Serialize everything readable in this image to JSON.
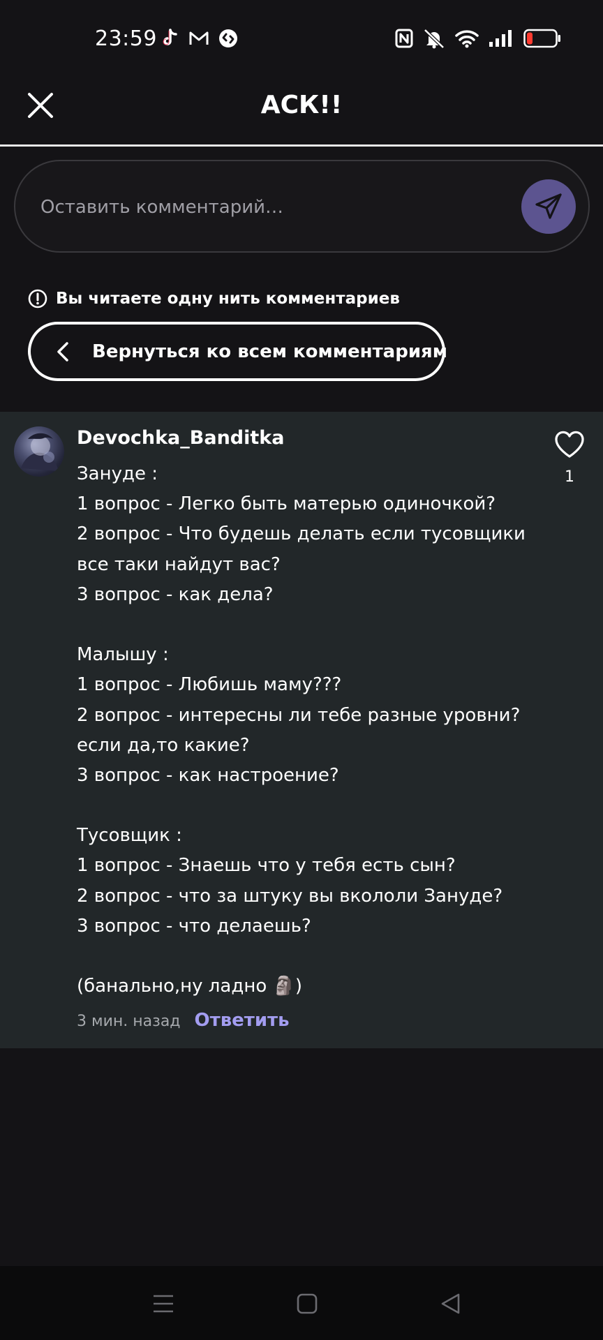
{
  "status_bar": {
    "time": "23:59",
    "left_icons": [
      "tiktok-icon",
      "gmail-icon",
      "shazam-icon"
    ],
    "right_icons": [
      "nfc-icon",
      "mute-icon",
      "wifi-icon",
      "signal-icon",
      "battery-low-icon"
    ]
  },
  "header": {
    "title": "АСК!!",
    "close_icon": "close-icon"
  },
  "comment_input": {
    "placeholder": "Оставить комментарий…",
    "value": "",
    "send_icon": "send-icon"
  },
  "thread": {
    "notice": "Вы читаете одну нить комментариев",
    "notice_icon": "info-icon",
    "back_label": "Вернуться ко всем комментариям"
  },
  "comment": {
    "author": "Devochka_Banditka",
    "lines": [
      "Зануде :",
      "1 вопрос - Легко быть матерью одиночкой?",
      "2 вопрос - Что будешь делать если тусовщики",
      "все таки найдут вас?",
      "3 вопрос - как дела?",
      "",
      "Малышу :",
      "1 вопрос - Любишь маму???",
      "2 вопрос - интересны ли тебе разные уровни?",
      "если да,то какие?",
      "3 вопрос - как настроение?",
      "",
      "Тусовщик :",
      "1 вопрос - Знаешь что у тебя есть сын?",
      "2 вопрос - что за штуку вы вкололи Зануде?",
      "3 вопрос - что делаешь?",
      "",
      "(банально,ну ладно 🗿)"
    ],
    "time": "3 мин. назад",
    "reply_label": "Ответить",
    "like_count": "1"
  },
  "colors": {
    "background": "#141316",
    "card": "#222729",
    "accent": "#a39df0",
    "send_button": "#5c5490"
  }
}
